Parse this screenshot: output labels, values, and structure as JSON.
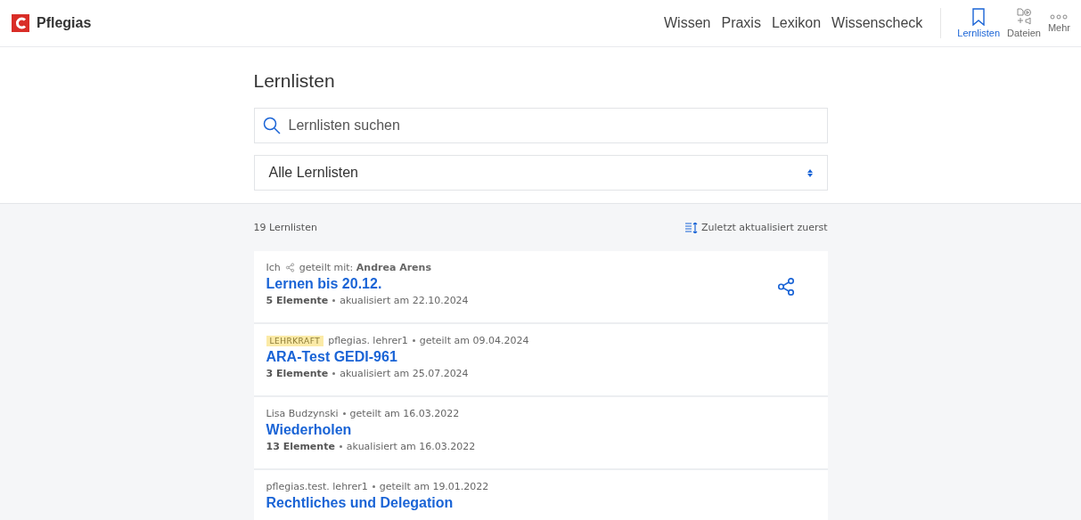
{
  "brand": "Pflegias",
  "nav": [
    {
      "label": "Wissen",
      "selected": false
    },
    {
      "label": "Praxis",
      "selected": false
    },
    {
      "label": "Lexikon",
      "selected": false
    },
    {
      "label": "Wissenscheck",
      "selected": false
    }
  ],
  "tools": [
    {
      "kind": "bookmark",
      "label": "Lernlisten",
      "selected": true
    },
    {
      "kind": "files",
      "label": "Dateien",
      "selected": false
    },
    {
      "kind": "more",
      "label": "Mehr",
      "selected": false
    }
  ],
  "page_title": "Lernlisten",
  "search": {
    "placeholder": "Lernlisten suchen"
  },
  "filter": {
    "value": "Alle Lernlisten"
  },
  "count": "19 Lernlisten",
  "sort": "Zuletzt aktualisiert zuerst",
  "lists": [
    {
      "kind": "shared_by_me",
      "owner": "Ich",
      "shared": "geteilt mit: **Andrea Arens**",
      "title": "Lernen bis 20.12.",
      "elements": "5 Elemente",
      "updated": "akualisiert am 22.10.2024"
    },
    {
      "kind": "shared_with_me",
      "badge": "LEHRKRAFT",
      "owner": "pflegias. lehrer1",
      "shared": "geteilt am 09.04.2024",
      "title": "ARA-Test GEDI-961",
      "elements": "3 Elemente",
      "updated": "akualisiert am 25.07.2024"
    },
    {
      "kind": "shared_with_me",
      "owner": "Lisa Budzynski",
      "shared": "geteilt am 16.03.2022",
      "title": "Wiederholen",
      "elements": "13 Elemente",
      "updated": "akualisiert am 16.03.2022"
    },
    {
      "kind": "shared_with_me",
      "owner": "pflegias.test. lehrer1",
      "shared": "geteilt am 19.01.2022",
      "title": "Rechtliches und Delegation"
    }
  ]
}
